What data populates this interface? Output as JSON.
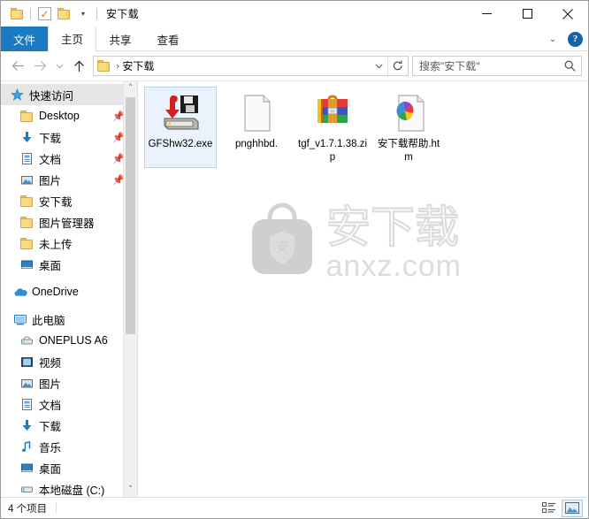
{
  "window": {
    "title": "安下载",
    "quick_access": [
      {
        "name": "qat-folder-icon",
        "icon": "folder-icon"
      },
      {
        "name": "qat-properties-icon",
        "icon": "properties-checkmark-icon"
      },
      {
        "name": "qat-new-folder-icon",
        "icon": "folder-icon"
      },
      {
        "name": "qat-customize-caret",
        "icon": "chevron-down-icon"
      }
    ],
    "controls": {
      "minimize": "minimize-icon",
      "maximize": "maximize-icon",
      "close": "close-icon"
    }
  },
  "ribbon": {
    "tabs": [
      {
        "label": "文件",
        "state": "file"
      },
      {
        "label": "主页",
        "state": "active"
      },
      {
        "label": "共享",
        "state": "normal"
      },
      {
        "label": "查看",
        "state": "normal"
      }
    ],
    "collapse_caret": "chevron-down-icon",
    "help_label": "?"
  },
  "navbar": {
    "back": "back-arrow-icon",
    "forward": "forward-arrow-icon",
    "recent": "chevron-down-icon",
    "up": "up-arrow-icon",
    "breadcrumb": {
      "folder_icon": "folder-icon",
      "separator": "›",
      "path": "安下载"
    },
    "address_caret": "chevron-down-icon",
    "refresh": "refresh-icon",
    "search": {
      "placeholder": "搜索\"安下载\"",
      "icon": "search-icon"
    }
  },
  "sidebar": {
    "groups": [
      {
        "header": {
          "label": "快速访问",
          "icon": "pin-star-icon",
          "selected": true
        },
        "items": [
          {
            "label": "Desktop",
            "icon": "folder-icon",
            "pinned": true
          },
          {
            "label": "下载",
            "icon": "download-arrow-icon",
            "pinned": true
          },
          {
            "label": "文档",
            "icon": "documents-icon",
            "pinned": true
          },
          {
            "label": "图片",
            "icon": "pictures-icon",
            "pinned": true
          },
          {
            "label": "安下载",
            "icon": "folder-icon",
            "pinned": false
          },
          {
            "label": "图片管理器",
            "icon": "folder-icon",
            "pinned": false
          },
          {
            "label": "未上传",
            "icon": "folder-icon",
            "pinned": false
          },
          {
            "label": "桌面",
            "icon": "desktop-icon",
            "pinned": false
          }
        ]
      },
      {
        "header": {
          "label": "OneDrive",
          "icon": "onedrive-cloud-icon",
          "selected": false
        },
        "items": []
      },
      {
        "header": {
          "label": "此电脑",
          "icon": "this-pc-icon",
          "selected": false
        },
        "items": [
          {
            "label": "ONEPLUS A6",
            "icon": "portable-device-icon",
            "pinned": false
          },
          {
            "label": "视频",
            "icon": "videos-icon",
            "pinned": false
          },
          {
            "label": "图片",
            "icon": "pictures-icon",
            "pinned": false
          },
          {
            "label": "文档",
            "icon": "documents-icon",
            "pinned": false
          },
          {
            "label": "下载",
            "icon": "download-arrow-icon",
            "pinned": false
          },
          {
            "label": "音乐",
            "icon": "music-note-icon",
            "pinned": false
          },
          {
            "label": "桌面",
            "icon": "desktop-icon",
            "pinned": false
          },
          {
            "label": "本地磁盘 (C:)",
            "icon": "local-disk-icon",
            "pinned": false
          }
        ]
      }
    ],
    "scroll_up": "chevron-up-icon",
    "scroll_down": "chevron-down-icon"
  },
  "files": [
    {
      "label": "GFShw32.exe",
      "icon": "exe-install-icon",
      "selected": true
    },
    {
      "label": "pnghhbd.",
      "icon": "blank-file-icon",
      "selected": false
    },
    {
      "label": "tgf_v1.7.1.38.zip",
      "icon": "winrar-archive-icon",
      "selected": false
    },
    {
      "label": "安下载帮助.htm",
      "icon": "html-pinwheel-icon",
      "selected": false
    }
  ],
  "watermark": {
    "logo_char": "安",
    "brand": "安下载",
    "site": "anxz.com"
  },
  "statusbar": {
    "item_count": "4 个项目",
    "views": [
      {
        "name": "details-view",
        "icon": "details-list-icon",
        "active": false
      },
      {
        "name": "large-icons-view",
        "icon": "large-icons-icon",
        "active": true
      }
    ]
  },
  "colors": {
    "accent": "#1a7bc4",
    "selection": "#eaf3fb",
    "selection_border": "#b5d7ef",
    "folder": "#fbdc82",
    "watermark": "#dcdcdc"
  }
}
